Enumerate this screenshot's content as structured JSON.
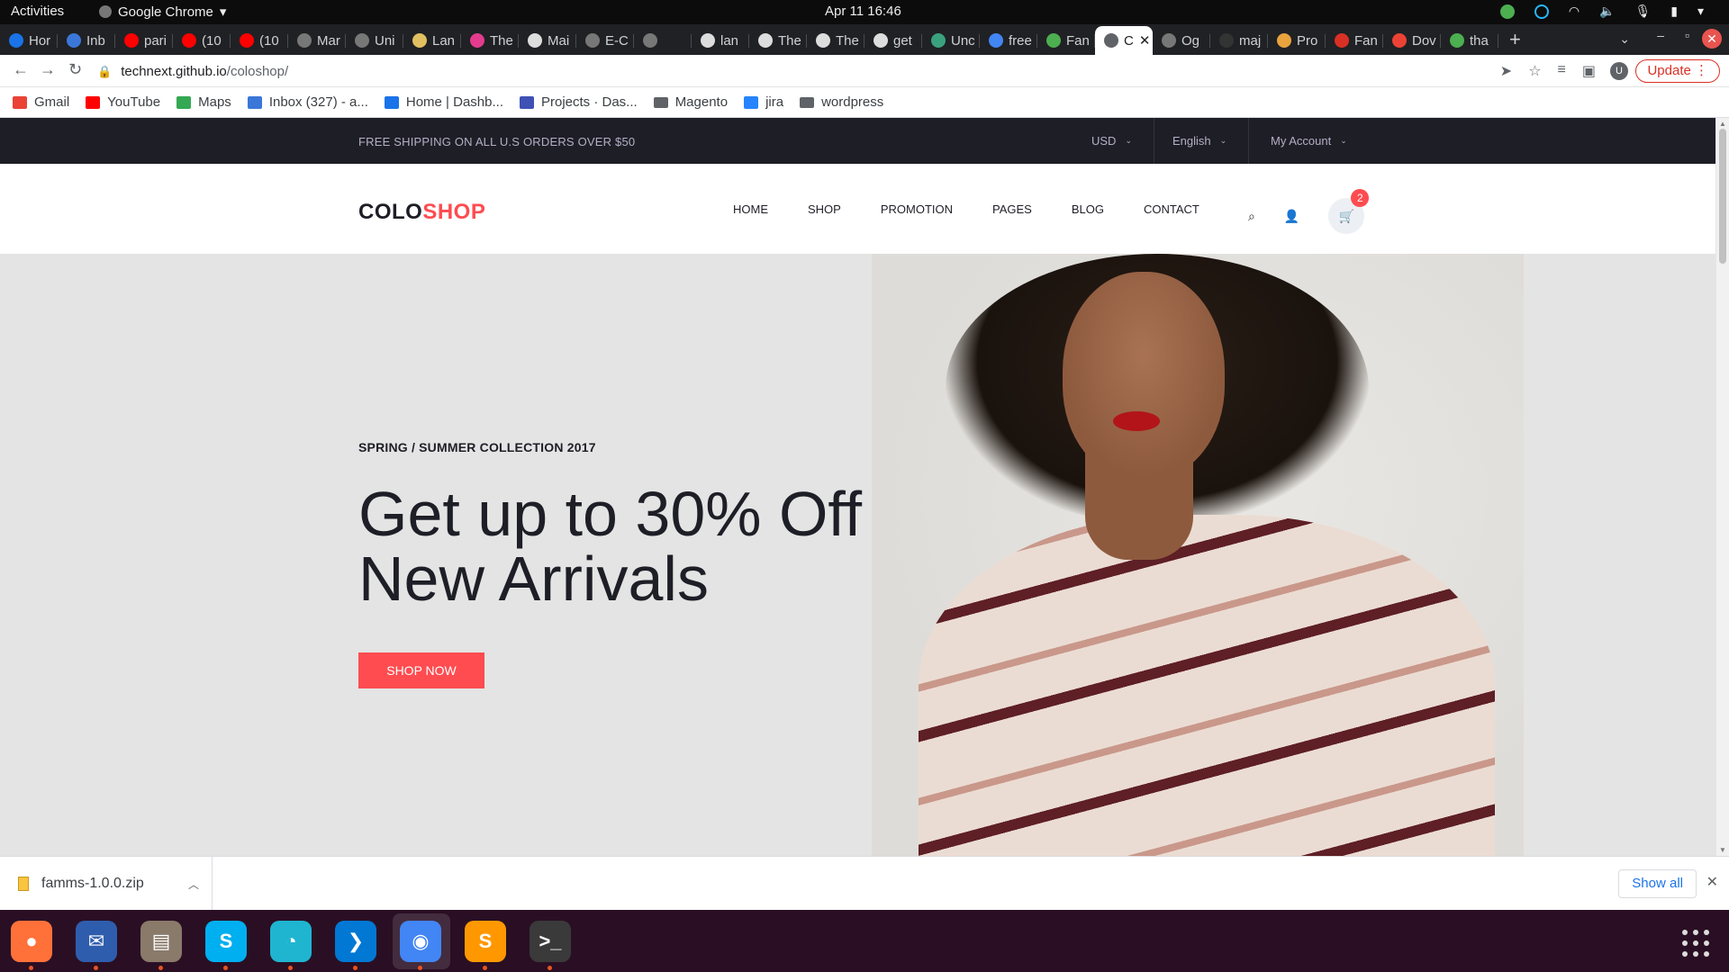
{
  "system": {
    "activities": "Activities",
    "app_name": "Google Chrome",
    "clock": "Apr 11  16:46"
  },
  "tabs": [
    {
      "label": "Hor",
      "color": "#1a73e8"
    },
    {
      "label": "Inb",
      "color": "#3b77d8"
    },
    {
      "label": "pari",
      "color": "#ff0000"
    },
    {
      "label": "(10",
      "color": "#ff0000"
    },
    {
      "label": "(10",
      "color": "#ff0000"
    },
    {
      "label": "Mar",
      "color": "#777777"
    },
    {
      "label": "Uni",
      "color": "#777777"
    },
    {
      "label": "Lan",
      "color": "#e0c060"
    },
    {
      "label": "The",
      "color": "#e33c8e"
    },
    {
      "label": "Mai",
      "color": "#dddddd"
    },
    {
      "label": "E-C",
      "color": "#777777"
    },
    {
      "label": "",
      "color": "#777777"
    },
    {
      "label": "lan",
      "color": "#dddddd"
    },
    {
      "label": "The",
      "color": "#dddddd"
    },
    {
      "label": "The",
      "color": "#dddddd"
    },
    {
      "label": "get",
      "color": "#dddddd"
    },
    {
      "label": "Unc",
      "color": "#3aa17e"
    },
    {
      "label": "free",
      "color": "#4285f4"
    },
    {
      "label": "Fan",
      "color": "#4caf50"
    },
    {
      "label": "C",
      "color": "#5f6368",
      "active": true
    },
    {
      "label": "Og",
      "color": "#777777"
    },
    {
      "label": "maj",
      "color": "#333333"
    },
    {
      "label": "Pro",
      "color": "#e8a33d"
    },
    {
      "label": "Fan",
      "color": "#d93025"
    },
    {
      "label": "Dov",
      "color": "#ea4335"
    },
    {
      "label": "tha",
      "color": "#4caf50"
    }
  ],
  "toolbar": {
    "url_host": "technext.github.io",
    "url_path": "/coloshop/",
    "avatar": "U",
    "update_label": "Update"
  },
  "bookmarks": [
    {
      "label": "Gmail",
      "color": "#ea4335"
    },
    {
      "label": "YouTube",
      "color": "#ff0000"
    },
    {
      "label": "Maps",
      "color": "#34a853"
    },
    {
      "label": "Inbox (327) - a...",
      "color": "#3b77d8"
    },
    {
      "label": "Home | Dashb...",
      "color": "#1a73e8"
    },
    {
      "label": "Projects · Das...",
      "color": "#3f51b5"
    },
    {
      "label": "Magento",
      "folder": true
    },
    {
      "label": "jira",
      "color": "#2684ff"
    },
    {
      "label": "wordpress",
      "folder": true
    }
  ],
  "site": {
    "top_bar": {
      "shipping": "FREE SHIPPING ON ALL U.S ORDERS OVER $50",
      "currency": "USD",
      "language": "English",
      "account": "My Account"
    },
    "logo_a": "COLO",
    "logo_b": "SHOP",
    "menu": [
      "HOME",
      "SHOP",
      "PROMOTION",
      "PAGES",
      "BLOG",
      "CONTACT"
    ],
    "cart_count": "2",
    "hero": {
      "subtitle": "SPRING / SUMMER COLLECTION 2017",
      "title": "Get up to 30% Off New Arrivals",
      "cta": "SHOP NOW"
    }
  },
  "download": {
    "filename": "famms-1.0.0.zip",
    "show_all": "Show all"
  },
  "colors": {
    "brand": "#fe4c50",
    "dark": "#1e1e27",
    "hero_bg": "#e4e4e4",
    "dock_bg": "#2a0f24"
  },
  "dock": [
    {
      "name": "firefox-icon",
      "color": "#ff7139",
      "glyph": "●"
    },
    {
      "name": "thunderbird-icon",
      "color": "#2f5dad",
      "glyph": "✉"
    },
    {
      "name": "files-icon",
      "color": "#8a7a6a",
      "glyph": "▤"
    },
    {
      "name": "skype-icon",
      "color": "#00aff0",
      "glyph": "S"
    },
    {
      "name": "timer-icon",
      "color": "#1fb5d0",
      "glyph": "◔"
    },
    {
      "name": "vscode-icon",
      "color": "#0078d4",
      "glyph": "❯"
    },
    {
      "name": "chrome-icon",
      "color": "#4285f4",
      "glyph": "◉"
    },
    {
      "name": "sublime-icon",
      "color": "#ff9800",
      "glyph": "S"
    },
    {
      "name": "terminal-icon",
      "color": "#3a3a3a",
      "glyph": ">_"
    }
  ]
}
